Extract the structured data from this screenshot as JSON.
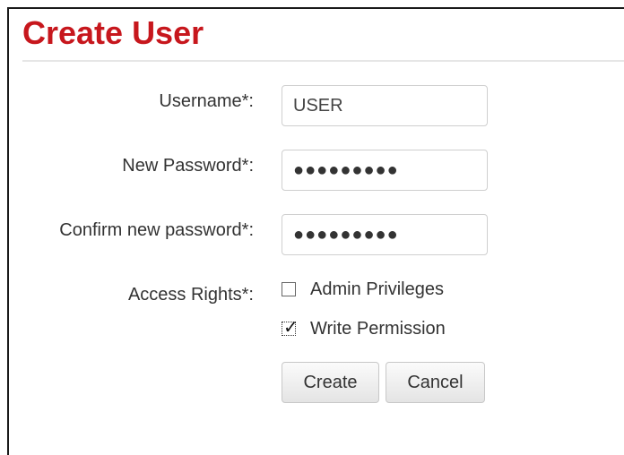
{
  "page": {
    "title": "Create User"
  },
  "form": {
    "username": {
      "label": "Username*:",
      "value": "USER"
    },
    "new_password": {
      "label": "New Password*:",
      "value": "●●●●●●●●●"
    },
    "confirm_password": {
      "label": "Confirm new password*:",
      "value": "●●●●●●●●●"
    },
    "access_rights": {
      "label": "Access Rights*:",
      "options": [
        {
          "label": "Admin Privileges",
          "checked": false
        },
        {
          "label": "Write Permission",
          "checked": true
        }
      ]
    },
    "create_label": "Create",
    "cancel_label": "Cancel"
  },
  "colors": {
    "title": "#c7171d",
    "text": "#333333",
    "field_border": "#cfcfcf"
  }
}
